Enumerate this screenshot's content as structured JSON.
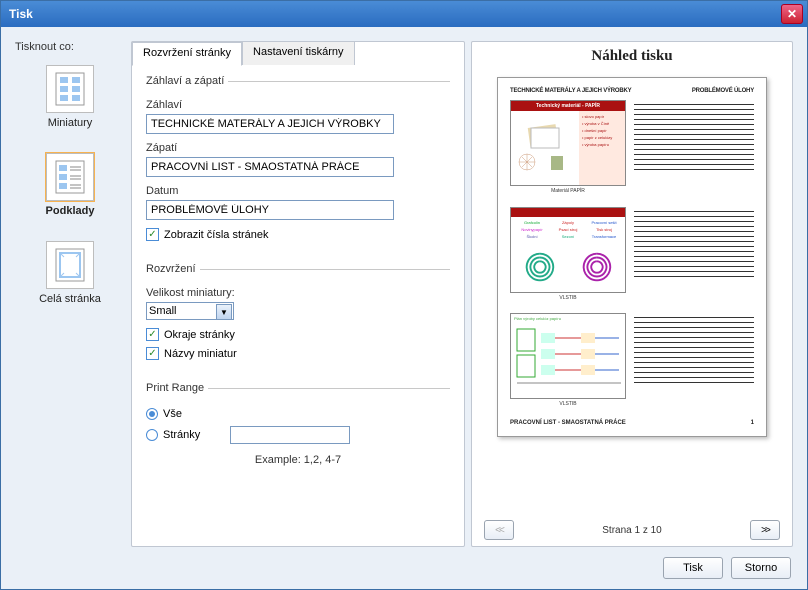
{
  "window": {
    "title": "Tisk"
  },
  "left": {
    "label": "Tisknout co:",
    "items": [
      {
        "label": "Miniatury"
      },
      {
        "label": "Podklady"
      },
      {
        "label": "Celá stránka"
      }
    ]
  },
  "tabs": {
    "layout": "Rozvržení stránky",
    "printer": "Nastavení tiskárny"
  },
  "headerFooter": {
    "legend": "Záhlaví a zápatí",
    "headerLabel": "Záhlaví",
    "headerValue": "TECHNICKÉ MATERÁLY A JEJICH VÝROBKY",
    "footerLabel": "Zápatí",
    "footerValue": "PRACOVNÍ LIST - SMAOSTATNÁ PRÁCE",
    "dateLabel": "Datum",
    "dateValue": "PROBLÉMOVÉ ÚLOHY",
    "showPageNumbers": "Zobrazit čísla stránek"
  },
  "layout": {
    "legend": "Rozvržení",
    "thumbSizeLabel": "Velikost miniatury:",
    "thumbSizeValue": "Small",
    "pageBorders": "Okraje stránky",
    "thumbNames": "Názvy miniatur"
  },
  "printRange": {
    "legend": "Print Range",
    "all": "Vše",
    "pages": "Stránky",
    "example": "Example:   1,2, 4-7"
  },
  "preview": {
    "title": "Náhled tisku",
    "headLeft": "TECHNICKÉ MATERÁLY A JEJICH VÝROBKY",
    "headRight": "PROBLÉMOVÉ ÚLOHY",
    "slide1Title": "Technický materiál - PAPÍR",
    "slide1Caption": "Materiál PAPÍR",
    "slide2Caption": "VLSTIB",
    "slide3Caption": "VLSTIB",
    "slide3Head": "Plán výroby celulóz papíru",
    "footLeft": "PRACOVNÍ LIST - SMAOSTATNÁ PRÁCE",
    "footRight": "1",
    "pageStatus": "Strana 1 z 10"
  },
  "buttons": {
    "print": "Tisk",
    "cancel": "Storno"
  }
}
